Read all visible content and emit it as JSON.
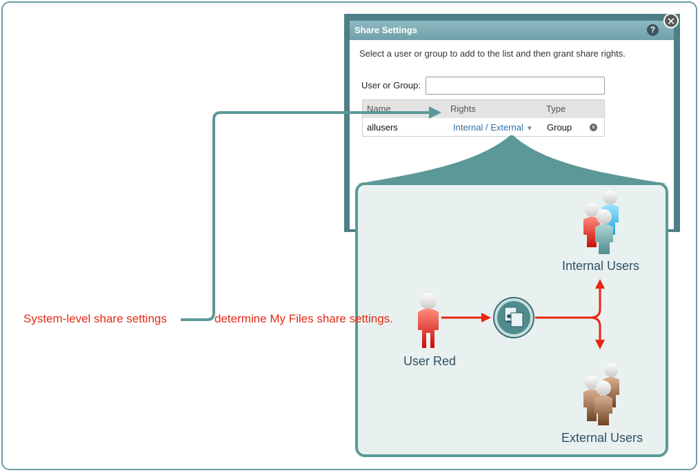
{
  "dialog": {
    "title": "Share Settings",
    "help_icon": "?",
    "close_icon": "✕",
    "instructions": "Select a user or group to add to the list and then grant share rights.",
    "user_or_group_label": "User or Group:",
    "user_or_group_value": "",
    "columns": [
      "Name",
      "Rights",
      "Type"
    ],
    "rows": [
      {
        "name": "allusers",
        "rights": "Internal / External",
        "type": "Group"
      }
    ]
  },
  "diagram": {
    "internal_users_label": "Internal Users",
    "user_red_label": "User Red",
    "external_users_label": "External Users",
    "caption_left": "System-level share settings",
    "caption_right": "determine My Files share settings."
  },
  "colors": {
    "teal": "#5c9898",
    "arrow_red": "#e8270f",
    "caption_red": "#e02a14"
  },
  "icons": {
    "help": "help-icon",
    "close": "close-icon",
    "remove": "remove-icon",
    "share_hub": "share-files-icon",
    "user_red": "user-red-icon",
    "internal_users": "internal-users-icon",
    "external_users": "external-users-icon"
  }
}
